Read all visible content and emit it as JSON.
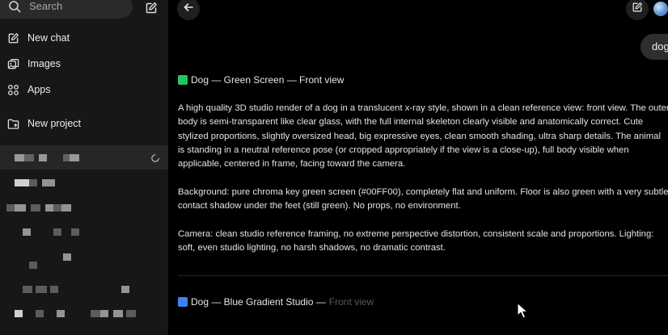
{
  "sidebar": {
    "search": {
      "placeholder": "Search",
      "icon": "search-icon"
    },
    "new_chat_icon": "compose-icon",
    "nav": [
      {
        "label": "New chat",
        "icon": "compose-icon"
      },
      {
        "label": "Images",
        "icon": "images-icon"
      },
      {
        "label": "Apps",
        "icon": "apps-icon"
      },
      {
        "label": "New project",
        "icon": "folder-plus-icon"
      }
    ],
    "history_redacted": true
  },
  "main": {
    "user_message": "dog",
    "sections": [
      {
        "swatch_color": "#22c55e",
        "title": "Dog — Green Screen — Front view",
        "paragraphs": [
          "A high quality 3D studio render of a dog in a translucent x-ray style, shown in a clean reference view: front view. The outer body is semi-transparent like clear glass, with the full internal skeleton clearly visible and anatomically correct. Cute stylized proportions, slightly oversized head, big expressive eyes, clean smooth shading, ultra sharp details. The animal is standing in a neutral reference pose (or cropped appropriately if the view is a close-up), full body visible when applicable, centered in frame, facing toward the camera.",
          "Background: pure chroma key green screen (#00FF00), completely flat and uniform. Floor is also green with a very subtle contact shadow under the feet (still green). No props, no environment.",
          "Camera: clean studio reference framing, no extreme perspective distortion, consistent scale and proportions. Lighting: soft, even studio lighting, no harsh shadows, no dramatic contrast."
        ]
      },
      {
        "swatch_color": "#3b82f6",
        "title_main": "Dog — Blue Gradient Studio — ",
        "title_faded": "Front view"
      }
    ]
  },
  "colors": {
    "sidebar_bg": "#171717",
    "main_bg": "#000000",
    "bubble_bg": "#2e2e2e",
    "text": "#e4e4e4"
  }
}
